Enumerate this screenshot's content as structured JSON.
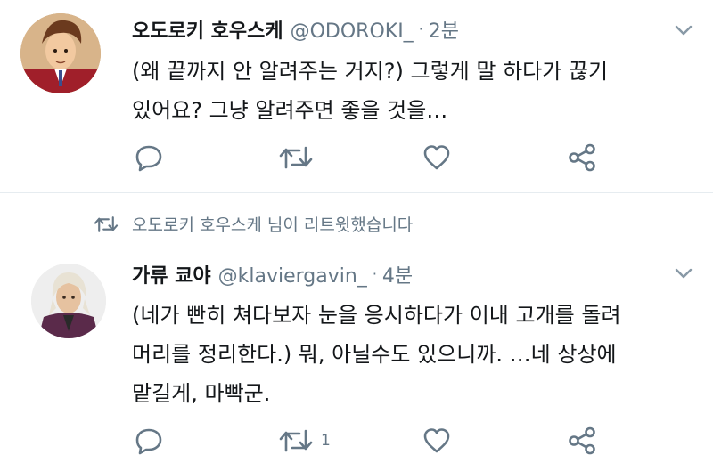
{
  "tweets": [
    {
      "name": "오도로키 호우스케",
      "handle": "@ODOROKI_",
      "separator": "·",
      "time": "2분",
      "lines": [
        "(왜 끝까지 안 알려주는 거지?) 그렇게 말 하다가 끊기",
        "있어요? 그냥 알려주면 좋을 것을…"
      ],
      "retweet_count": ""
    },
    {
      "name": "가류 쿄야",
      "handle": "@klaviergavin_",
      "separator": "·",
      "time": "4분",
      "lines": [
        "(네가 빤히 쳐다보자 눈을 응시하다가 이내 고개를 돌려",
        "머리를 정리한다.) 뭐, 아닐수도 있으니까. …네 상상에",
        "맡길게, 마빡군."
      ],
      "retweet_count": "1"
    }
  ],
  "retweet_notice": "오도로키 호우스케 님이 리트윗했습니다",
  "colors": {
    "text": "#14171a",
    "secondary": "#657786",
    "icon": "#657786",
    "divider": "#e6ecf0"
  },
  "icons": [
    "reply-icon",
    "retweet-icon",
    "like-icon",
    "share-icon",
    "chevron-down-icon"
  ]
}
